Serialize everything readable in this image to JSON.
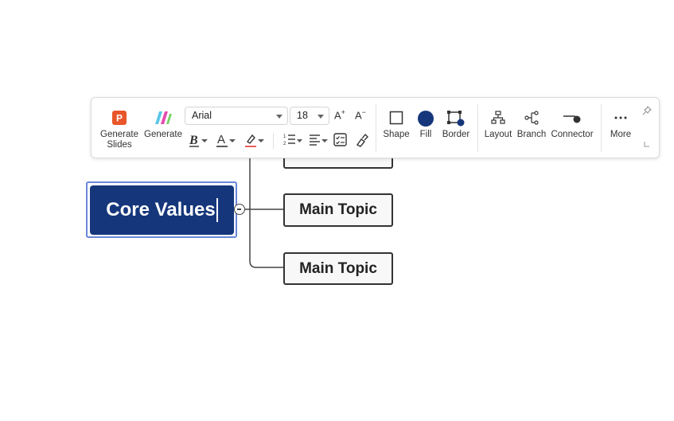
{
  "toolbar": {
    "generate_slides": "Generate\nSlides",
    "generate": "Generate",
    "font_family": "Arial",
    "font_size": "18",
    "increase_font": "A",
    "decrease_font": "A",
    "shape": "Shape",
    "fill": "Fill",
    "border": "Border",
    "layout": "Layout",
    "branch": "Branch",
    "connector": "Connector",
    "more": "More"
  },
  "mindmap": {
    "central_topic": "Core Values",
    "topics": [
      "Main Topic",
      "Main Topic"
    ]
  },
  "colors": {
    "central_fill": "#15367b",
    "selection_border": "#6a86d6",
    "fill_swatch": "#15367b",
    "slides_icon": "#e8562a"
  },
  "icons": {
    "generate_slides": "powerpoint-icon",
    "generate": "ai-generate-icon",
    "bold": "bold-icon",
    "font_color": "font-color-icon",
    "highlight": "highlight-icon",
    "numbering": "numbered-list-icon",
    "align": "align-icon",
    "checklist": "checklist-icon",
    "format_painter": "format-painter-icon",
    "shape": "shape-square-icon",
    "fill": "fill-circle-icon",
    "border": "border-icon",
    "layout": "layout-icon",
    "branch": "branch-icon",
    "connector": "connector-icon",
    "more": "more-dots-icon",
    "pin": "pin-icon"
  }
}
